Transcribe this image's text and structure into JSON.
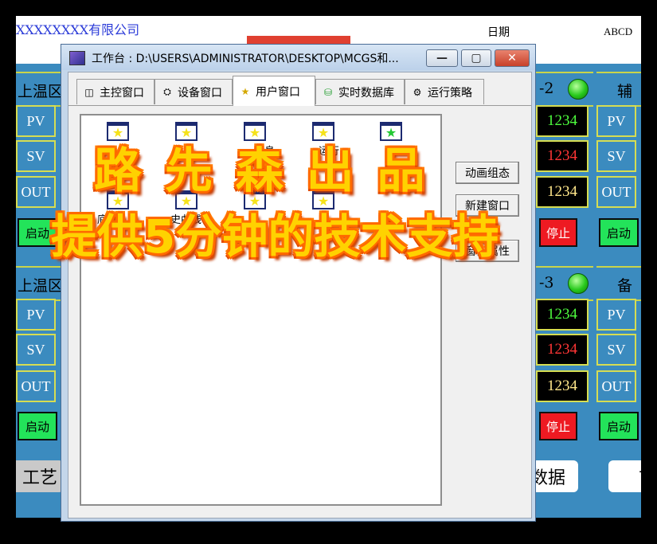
{
  "app": {
    "company": "XXXXXXXX有限公司",
    "date_label": "日期",
    "date_value": "ABCD",
    "zones": {
      "left_top_label": "上温区",
      "left_bottom_label": "上温区",
      "right_top_label": "-2",
      "right_bottom_label": "-3",
      "far_right_top_label": "辅热",
      "far_right_bottom_label": "备用"
    },
    "rows": {
      "pv": "PV",
      "sv": "SV",
      "out": "OUT"
    },
    "values_top": [
      "1234",
      "1234",
      "1234"
    ],
    "values_bottom": [
      "1234",
      "1234",
      "1234"
    ],
    "start_label": "启动",
    "stop_label": "停止",
    "nav": {
      "left": "工艺",
      "middle": "数据",
      "right": "首"
    }
  },
  "dialog": {
    "title": "工作台 : D:\\USERS\\ADMINISTRATOR\\DESKTOP\\MCGS和...",
    "tabs": [
      {
        "label": "主控窗口",
        "icon": "main-window-icon"
      },
      {
        "label": "设备窗口",
        "icon": "device-window-icon"
      },
      {
        "label": "用户窗口",
        "icon": "user-window-icon"
      },
      {
        "label": "实时数据库",
        "icon": "database-icon"
      },
      {
        "label": "运行策略",
        "icon": "strategy-icon"
      }
    ],
    "items": [
      {
        "label": ""
      },
      {
        "label": ""
      },
      {
        "label": "息"
      },
      {
        "label": "运行"
      },
      {
        "label": "页"
      },
      {
        "label": "底"
      },
      {
        "label": "史曲线"
      },
      {
        "label": ""
      },
      {
        "label": ""
      }
    ],
    "buttons": {
      "animation": "动画组态",
      "new_window": "新建窗口",
      "window_props": "窗口属性"
    }
  },
  "watermark": {
    "line1": "路 先 森 出 品",
    "line2": "提供5分钟的技术支持"
  }
}
